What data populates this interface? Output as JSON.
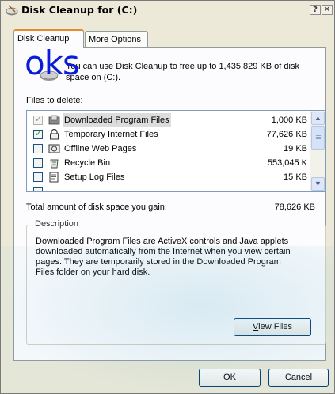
{
  "window": {
    "title": "Disk Cleanup for  (C:)",
    "help_glyph": "?",
    "close_glyph": "✕"
  },
  "watermark": "oks",
  "tabs": [
    {
      "label": "Disk Cleanup",
      "active": true
    },
    {
      "label": "More Options",
      "active": false
    }
  ],
  "intro": {
    "line1": "You can use Disk Cleanup to free up to 1,435,829 KB of disk",
    "line2": "space on  (C:)."
  },
  "files_label_pre": "",
  "files_label_accel": "F",
  "files_label_post": "iles to delete:",
  "files": [
    {
      "name": "Downloaded Program Files",
      "size": "1,000 KB",
      "checked": true,
      "disabled": true,
      "selected": true,
      "icon": "folder-download-icon"
    },
    {
      "name": "Temporary Internet Files",
      "size": "77,626 KB",
      "checked": true,
      "disabled": false,
      "selected": false,
      "icon": "lock-icon"
    },
    {
      "name": "Offline Web Pages",
      "size": "19 KB",
      "checked": false,
      "disabled": false,
      "selected": false,
      "icon": "offline-page-icon"
    },
    {
      "name": "Recycle Bin",
      "size": "553,045 K",
      "checked": false,
      "disabled": false,
      "selected": false,
      "icon": "recycle-bin-icon"
    },
    {
      "name": "Setup Log Files",
      "size": "15 KB",
      "checked": false,
      "disabled": false,
      "selected": false,
      "icon": "log-file-icon"
    }
  ],
  "scroll": {
    "up": "▲",
    "down": "▼"
  },
  "total": {
    "label": "Total amount of disk space you gain:",
    "value": "78,626 KB"
  },
  "description": {
    "legend": "Description",
    "line1": "Downloaded Program Files are ActiveX controls and Java applets",
    "line2": "downloaded automatically from the Internet when you view certain",
    "line3": "pages. They are temporarily stored in the Downloaded Program",
    "line4": "Files folder on your hard disk."
  },
  "buttons": {
    "view_files_accel": "V",
    "view_files_rest": "iew Files",
    "ok": "OK",
    "cancel": "Cancel"
  },
  "colors": {
    "tab_accent": "#e68b2c",
    "watermark": "#0a1cd8",
    "check": "#21a121"
  }
}
